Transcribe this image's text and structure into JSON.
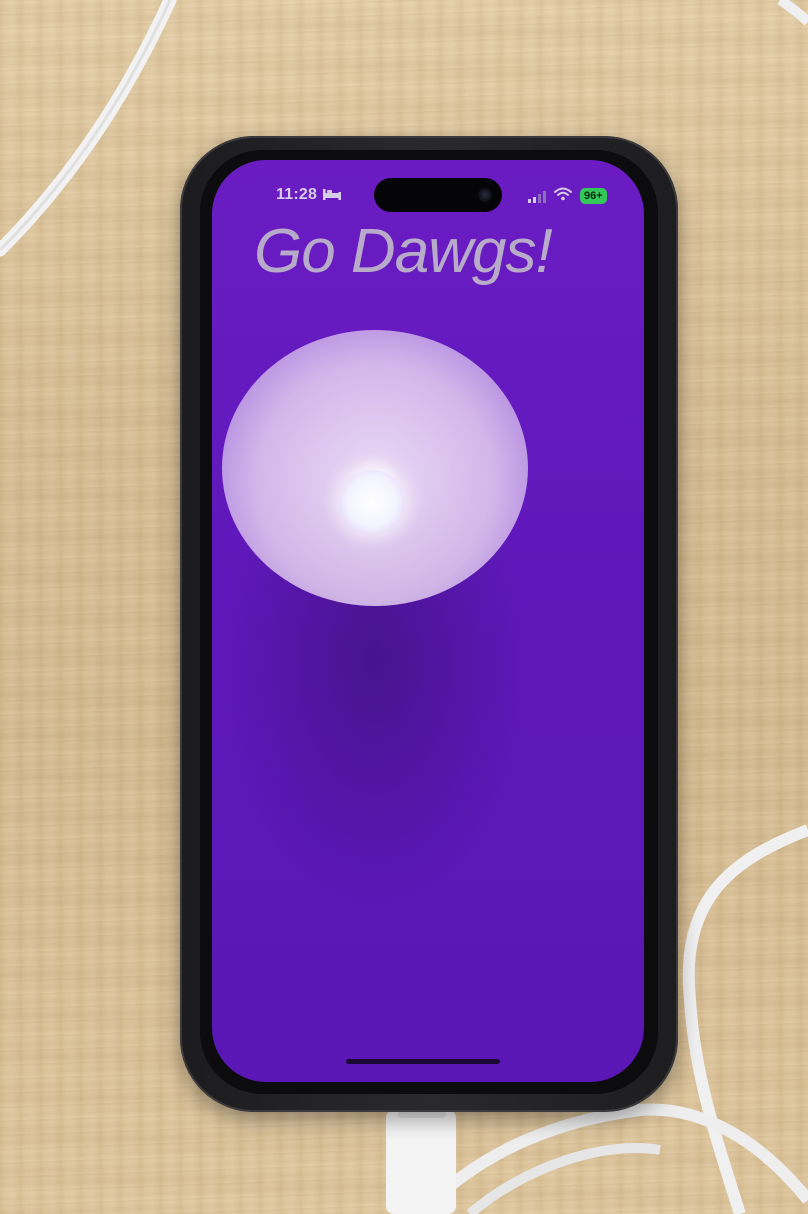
{
  "status_bar": {
    "time": "11:28",
    "focus_icon": "bed-icon",
    "battery": "96"
  },
  "screen": {
    "headline": "Go Dawgs!",
    "background_color": "#6219bd",
    "headline_color": "#b7abc9"
  }
}
